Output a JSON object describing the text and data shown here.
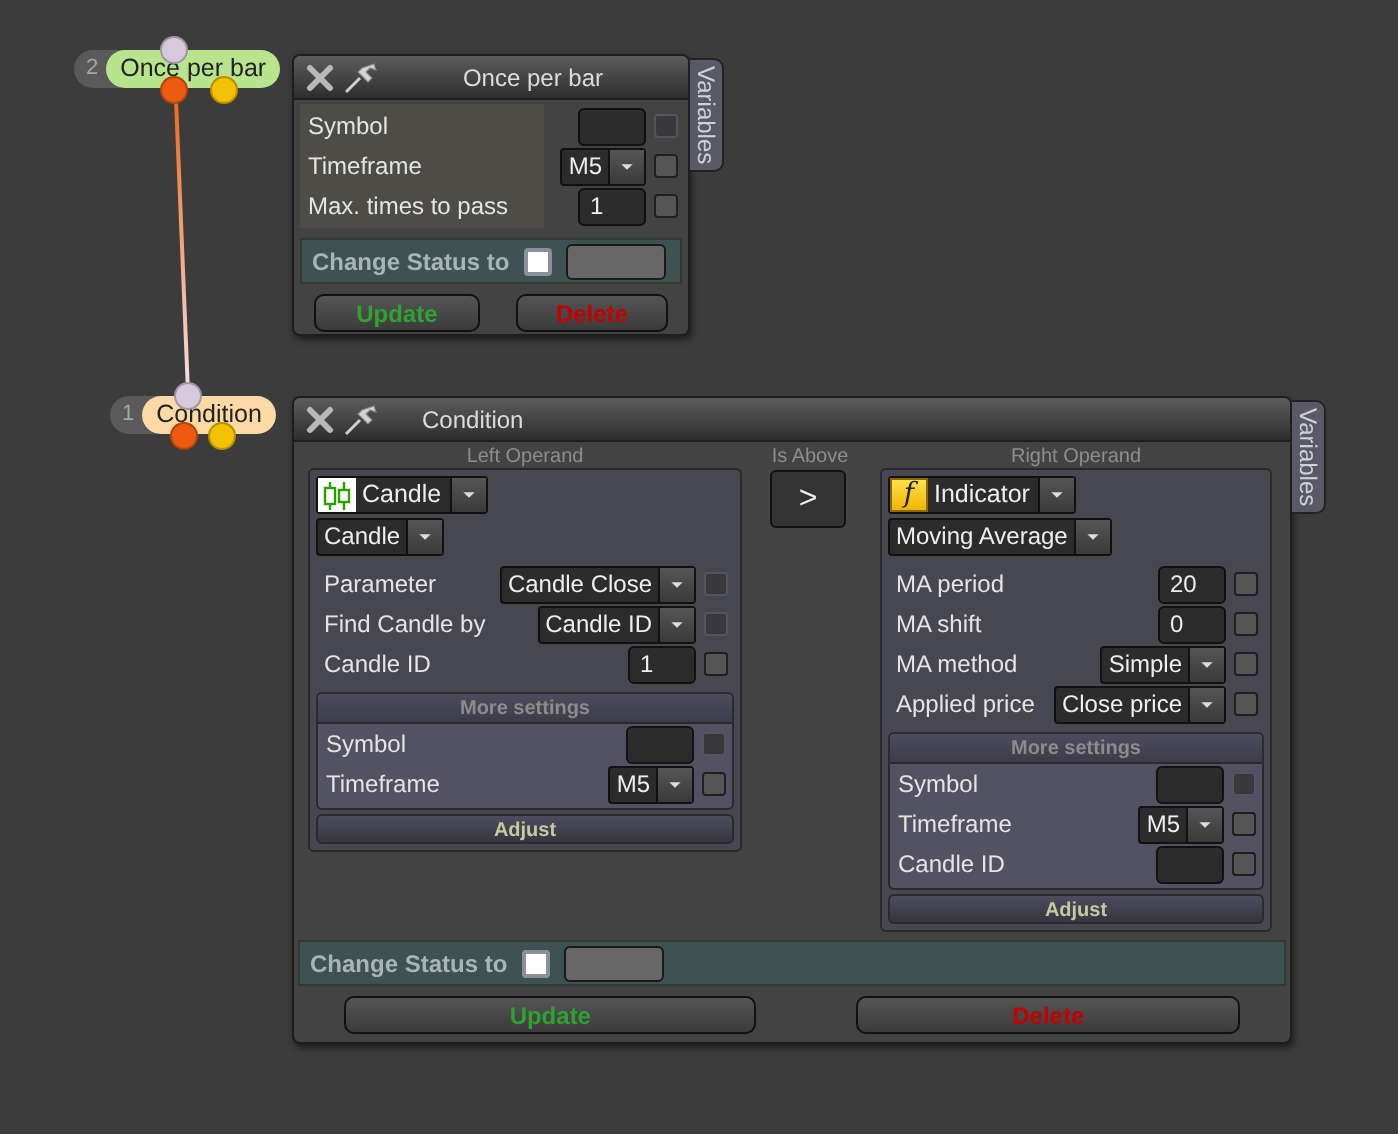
{
  "nodes": [
    {
      "number": "2",
      "label": "Once per bar",
      "color": "#b9e48e"
    },
    {
      "number": "1",
      "label": "Condition",
      "color": "#fdd9a6"
    }
  ],
  "windows": [
    {
      "kind": "simple",
      "title": "Once per bar",
      "side_tab": "Variables",
      "rows": [
        {
          "label": "Symbol",
          "kind": "input",
          "checkbox": {
            "checked": false,
            "disabled": true
          }
        },
        {
          "label": "Timeframe",
          "kind": "select",
          "value": "M5",
          "checkbox": {
            "checked": false,
            "disabled": false
          }
        },
        {
          "label": "Max. times to pass",
          "kind": "input",
          "value": "1",
          "checkbox": {
            "checked": false,
            "disabled": false
          }
        }
      ],
      "status": {
        "label": "Change Status to",
        "checked": false
      },
      "buttons": [
        {
          "label": "Update",
          "color": "#2fa22f"
        },
        {
          "label": "Delete",
          "color": "#c40000"
        }
      ]
    },
    {
      "kind": "condition",
      "title": "Condition",
      "side_tab": "Variables",
      "left_operand": {
        "heading": "Left Operand",
        "type": {
          "kind": "candle",
          "value": "Candle"
        },
        "subtype": "Candle",
        "rows": [
          {
            "label": "Parameter",
            "kind": "select",
            "value": "Candle Close",
            "checkbox": {
              "checked": false,
              "disabled": true
            }
          },
          {
            "label": "Find Candle by",
            "kind": "select",
            "value": "Candle ID",
            "checkbox": {
              "checked": false,
              "disabled": true
            }
          },
          {
            "label": "Candle ID",
            "kind": "input",
            "value": "1",
            "checkbox": {
              "checked": false,
              "disabled": false
            }
          }
        ],
        "more_settings": {
          "title": "More settings",
          "rows": [
            {
              "label": "Symbol",
              "kind": "input",
              "checkbox": {
                "checked": false,
                "disabled": true
              }
            },
            {
              "label": "Timeframe",
              "kind": "select",
              "value": "M5",
              "checkbox": {
                "checked": false,
                "disabled": false
              }
            }
          ]
        },
        "adjust": "Adjust"
      },
      "comparator": {
        "heading": "Is Above",
        "symbol": ">"
      },
      "right_operand": {
        "heading": "Right Operand",
        "type": {
          "kind": "function",
          "glyph": "f",
          "value": "Indicator"
        },
        "subtype": "Moving Average",
        "rows": [
          {
            "label": "MA period",
            "kind": "input",
            "value": "20",
            "checkbox": {
              "checked": false,
              "disabled": false
            }
          },
          {
            "label": "MA shift",
            "kind": "input",
            "value": "0",
            "checkbox": {
              "checked": false,
              "disabled": false
            }
          },
          {
            "label": "MA method",
            "kind": "select",
            "value": "Simple",
            "checkbox": {
              "checked": false,
              "disabled": false
            }
          },
          {
            "label": "Applied price",
            "kind": "select",
            "value": "Close price",
            "checkbox": {
              "checked": false,
              "disabled": false
            }
          }
        ],
        "more_settings": {
          "title": "More settings",
          "rows": [
            {
              "label": "Symbol",
              "kind": "input",
              "checkbox": {
                "checked": false,
                "disabled": true
              }
            },
            {
              "label": "Timeframe",
              "kind": "select",
              "value": "M5",
              "checkbox": {
                "checked": false,
                "disabled": false
              }
            },
            {
              "label": "Candle ID",
              "kind": "input",
              "checkbox": {
                "checked": false,
                "disabled": false
              }
            }
          ]
        },
        "adjust": "Adjust"
      },
      "status": {
        "label": "Change Status to",
        "checked": false
      },
      "buttons": [
        {
          "label": "Update",
          "color": "#2fa22f"
        },
        {
          "label": "Delete",
          "color": "#c40000"
        }
      ]
    }
  ]
}
